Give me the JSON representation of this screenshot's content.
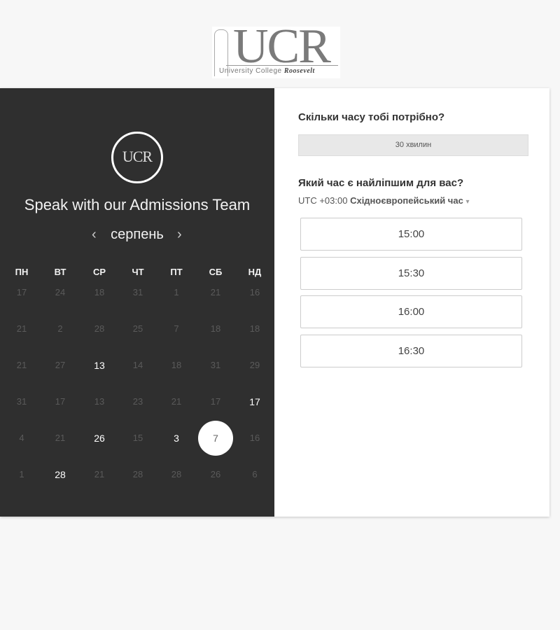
{
  "logo": {
    "text": "UCR",
    "subtitle": "University College",
    "subtitle_script": "Roosevelt"
  },
  "left": {
    "badge": "UCR",
    "headline": "Speak with our Admissions Team",
    "month": "серпень",
    "prev_icon": "‹",
    "next_icon": "›",
    "weekdays": [
      "ПН",
      "ВТ",
      "СР",
      "ЧТ",
      "ПТ",
      "СБ",
      "НД"
    ],
    "weeks": [
      [
        {
          "d": "17",
          "on": false
        },
        {
          "d": "24",
          "on": false
        },
        {
          "d": "18",
          "on": false
        },
        {
          "d": "31",
          "on": false
        },
        {
          "d": "1",
          "on": false
        },
        {
          "d": "21",
          "on": false
        },
        {
          "d": "16",
          "on": false
        }
      ],
      [
        {
          "d": "21",
          "on": false
        },
        {
          "d": "2",
          "on": false
        },
        {
          "d": "28",
          "on": false
        },
        {
          "d": "25",
          "on": false
        },
        {
          "d": "7",
          "on": false
        },
        {
          "d": "18",
          "on": false
        },
        {
          "d": "18",
          "on": false
        }
      ],
      [
        {
          "d": "21",
          "on": false
        },
        {
          "d": "27",
          "on": false
        },
        {
          "d": "13",
          "on": true
        },
        {
          "d": "14",
          "on": false
        },
        {
          "d": "18",
          "on": false
        },
        {
          "d": "31",
          "on": false
        },
        {
          "d": "29",
          "on": false
        }
      ],
      [
        {
          "d": "31",
          "on": false
        },
        {
          "d": "17",
          "on": false
        },
        {
          "d": "13",
          "on": false
        },
        {
          "d": "23",
          "on": false
        },
        {
          "d": "21",
          "on": false
        },
        {
          "d": "17",
          "on": false
        },
        {
          "d": "17",
          "on": true
        }
      ],
      [
        {
          "d": "4",
          "on": false
        },
        {
          "d": "21",
          "on": false
        },
        {
          "d": "26",
          "on": true
        },
        {
          "d": "15",
          "on": false
        },
        {
          "d": "3",
          "on": true
        },
        {
          "d": "7",
          "on": true,
          "selected": true
        },
        {
          "d": "16",
          "on": false
        }
      ],
      [
        {
          "d": "1",
          "on": false
        },
        {
          "d": "28",
          "on": true
        },
        {
          "d": "21",
          "on": false
        },
        {
          "d": "28",
          "on": false
        },
        {
          "d": "28",
          "on": false
        },
        {
          "d": "26",
          "on": false
        },
        {
          "d": "6",
          "on": false
        }
      ]
    ]
  },
  "right": {
    "duration_question": "Скільки часу тобі потрібно?",
    "duration_value": "30 хвилин",
    "time_question": "Який час є найліпшим для вас?",
    "timezone_offset": "UTC +03:00",
    "timezone_name": "Східноєвропейський час",
    "timezone_caret": "▾",
    "slots": [
      "15:00",
      "15:30",
      "16:00",
      "16:30"
    ]
  }
}
